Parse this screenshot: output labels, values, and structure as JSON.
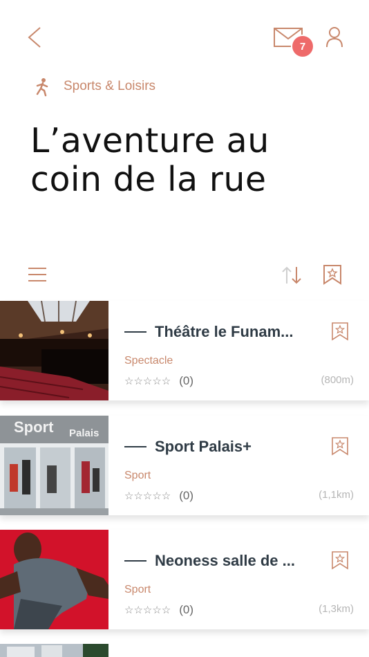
{
  "header": {
    "notification_count": "7",
    "category_label": "Sports & Loisirs",
    "title_line1": "L’aventure au",
    "title_line2": "coin de la rue"
  },
  "colors": {
    "accent": "#c8876b",
    "badge": "#ee6a6a",
    "text": "#2f3b45"
  },
  "icons": [
    "back-arrow-icon",
    "mail-icon",
    "user-icon",
    "runner-icon",
    "menu-icon",
    "sort-icon",
    "bookmark-star-icon",
    "star-icon"
  ],
  "listings": [
    {
      "name": "Théâtre le Funam...",
      "category": "Spectacle",
      "stars": "☆☆☆☆☆",
      "reviews": "(0)",
      "distance": "(800m)"
    },
    {
      "name": "Sport Palais+",
      "category": "Sport",
      "stars": "☆☆☆☆☆",
      "reviews": "(0)",
      "distance": "(1,1km)"
    },
    {
      "name": "Neoness salle de ...",
      "category": "Sport",
      "stars": "☆☆☆☆☆",
      "reviews": "(0)",
      "distance": "(1,3km)"
    }
  ],
  "thumb_texts": {
    "sport_sign_left": "Sport",
    "sport_sign_right": "Palais"
  }
}
